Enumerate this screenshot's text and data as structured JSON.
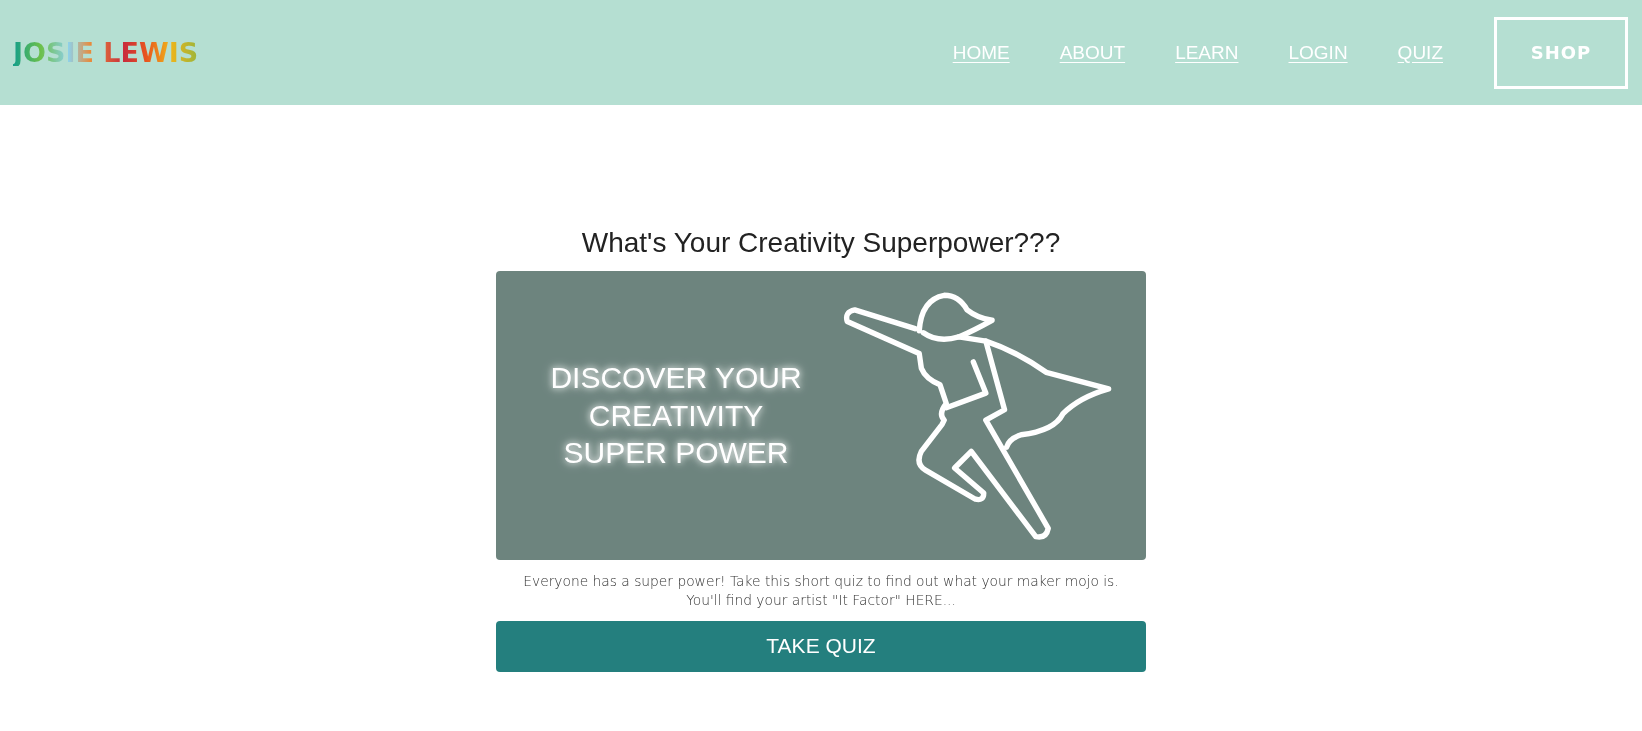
{
  "header": {
    "logo": "JOSIE LEWIS",
    "nav": [
      {
        "label": "HOME",
        "kind": "link"
      },
      {
        "label": "ABOUT",
        "kind": "link"
      },
      {
        "label": "LEARN",
        "kind": "link"
      },
      {
        "label": "LOGIN",
        "kind": "link"
      },
      {
        "label": "QUIZ",
        "kind": "link"
      },
      {
        "label": "SHOP",
        "kind": "button"
      }
    ]
  },
  "quiz": {
    "title": "What's Your Creativity Superpower???",
    "banner_text": "DISCOVER YOUR\nCREATIVITY\nSUPER POWER",
    "description": "Everyone has a super power! Take this short quiz to find out what your maker mojo is.\nYou'll find your artist \"It Factor\" HERE...",
    "button": "TAKE QUIZ"
  }
}
